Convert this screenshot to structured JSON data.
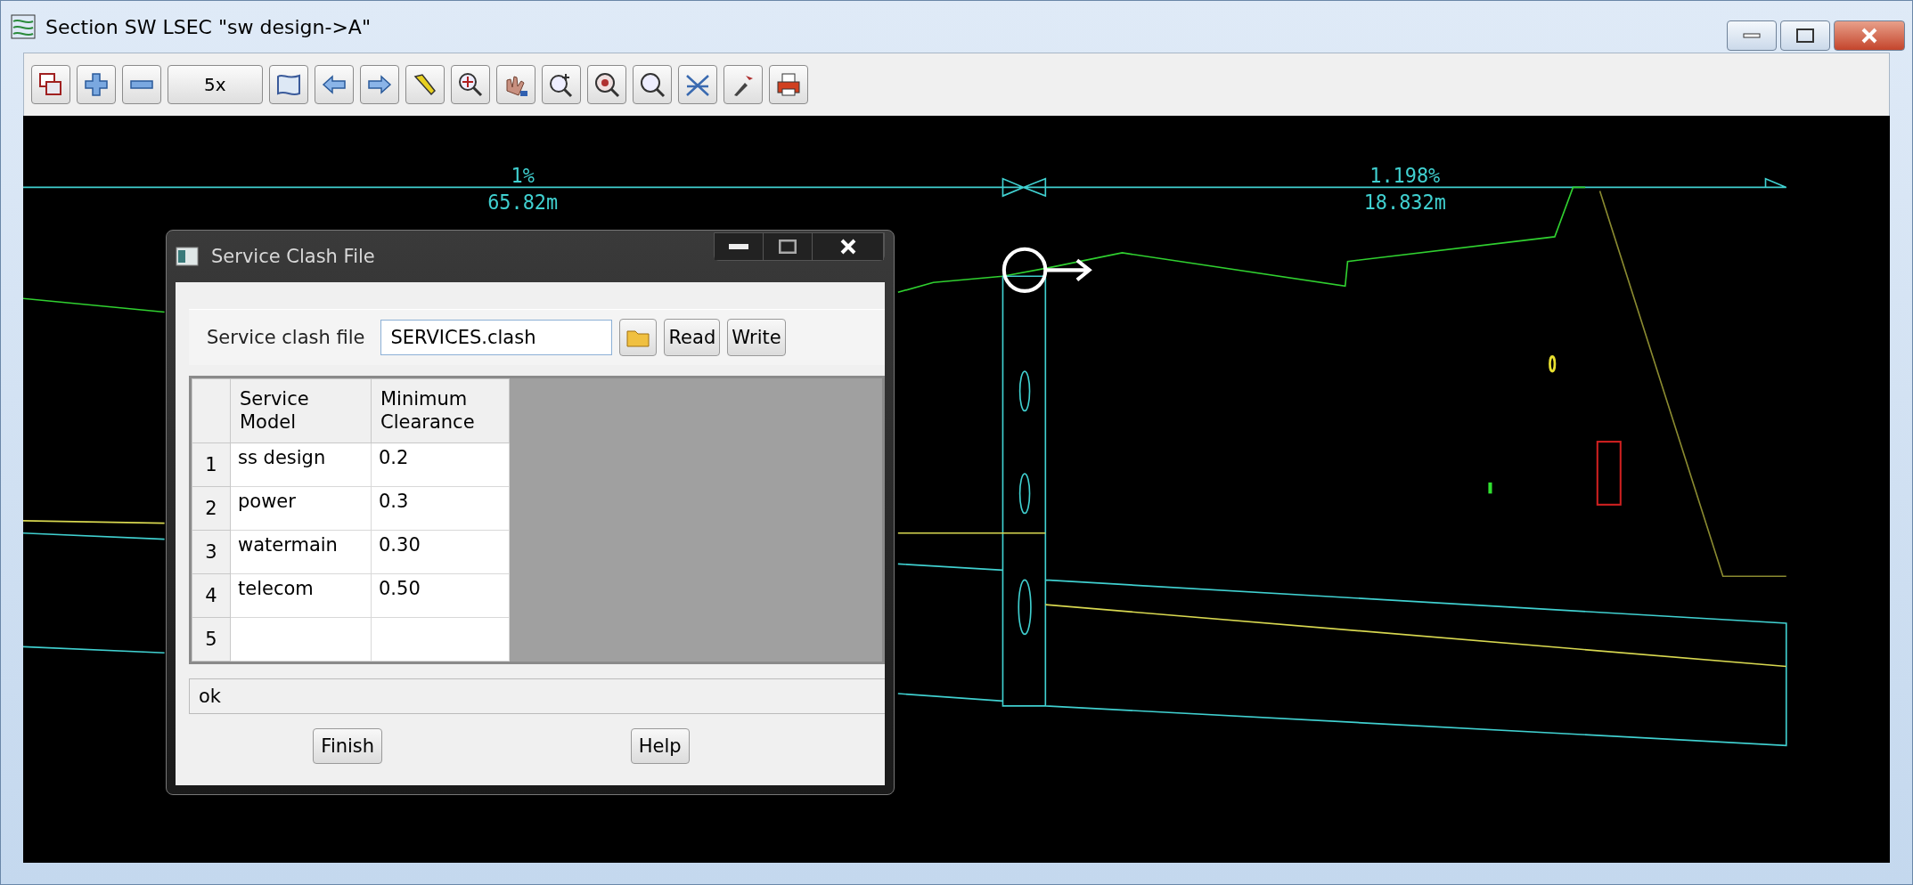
{
  "window": {
    "title": "Section SW LSEC \"sw design->A\""
  },
  "toolbar": {
    "zoom_factor": "5x"
  },
  "canvas": {
    "grade_labels": [
      {
        "grade": "1%",
        "length": "65.82m"
      },
      {
        "grade": "1.198%",
        "length": "18.832m"
      }
    ]
  },
  "dialog": {
    "title": "Service Clash File",
    "file_label": "Service clash file",
    "file_value": "SERVICES.clash",
    "buttons": [
      "Read",
      "Write"
    ],
    "table": {
      "columns": [
        "Service\nModel",
        "Minimum\nClearance"
      ],
      "rows": [
        {
          "number": "1",
          "model": "ss design",
          "clearance": "0.2"
        },
        {
          "number": "2",
          "model": "power",
          "clearance": "0.3"
        },
        {
          "number": "3",
          "model": "watermain",
          "clearance": "0.30"
        },
        {
          "number": "4",
          "model": "telecom",
          "clearance": "0.50"
        },
        {
          "number": "5"
        }
      ]
    },
    "status": "ok",
    "footer_buttons": [
      "Finish",
      "Help"
    ]
  }
}
